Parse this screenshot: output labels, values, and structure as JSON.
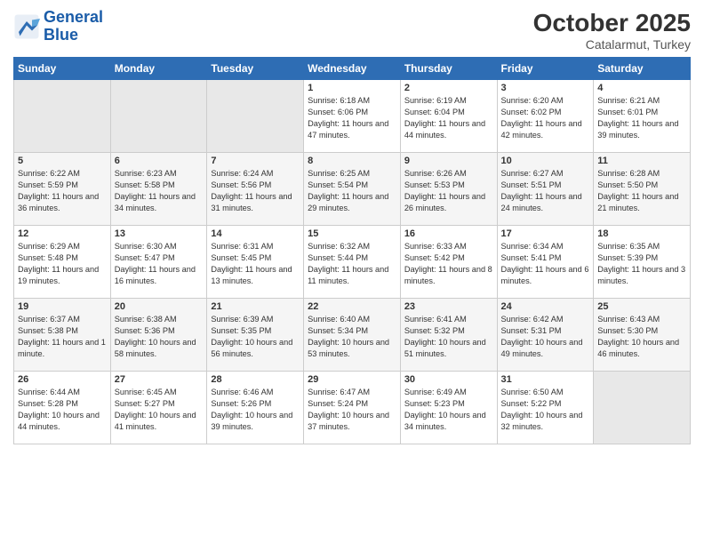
{
  "header": {
    "logo_line1": "General",
    "logo_line2": "Blue",
    "month_title": "October 2025",
    "location": "Catalarmut, Turkey"
  },
  "weekdays": [
    "Sunday",
    "Monday",
    "Tuesday",
    "Wednesday",
    "Thursday",
    "Friday",
    "Saturday"
  ],
  "weeks": [
    [
      {
        "day": "",
        "info": ""
      },
      {
        "day": "",
        "info": ""
      },
      {
        "day": "",
        "info": ""
      },
      {
        "day": "1",
        "info": "Sunrise: 6:18 AM\nSunset: 6:06 PM\nDaylight: 11 hours\nand 47 minutes."
      },
      {
        "day": "2",
        "info": "Sunrise: 6:19 AM\nSunset: 6:04 PM\nDaylight: 11 hours\nand 44 minutes."
      },
      {
        "day": "3",
        "info": "Sunrise: 6:20 AM\nSunset: 6:02 PM\nDaylight: 11 hours\nand 42 minutes."
      },
      {
        "day": "4",
        "info": "Sunrise: 6:21 AM\nSunset: 6:01 PM\nDaylight: 11 hours\nand 39 minutes."
      }
    ],
    [
      {
        "day": "5",
        "info": "Sunrise: 6:22 AM\nSunset: 5:59 PM\nDaylight: 11 hours\nand 36 minutes."
      },
      {
        "day": "6",
        "info": "Sunrise: 6:23 AM\nSunset: 5:58 PM\nDaylight: 11 hours\nand 34 minutes."
      },
      {
        "day": "7",
        "info": "Sunrise: 6:24 AM\nSunset: 5:56 PM\nDaylight: 11 hours\nand 31 minutes."
      },
      {
        "day": "8",
        "info": "Sunrise: 6:25 AM\nSunset: 5:54 PM\nDaylight: 11 hours\nand 29 minutes."
      },
      {
        "day": "9",
        "info": "Sunrise: 6:26 AM\nSunset: 5:53 PM\nDaylight: 11 hours\nand 26 minutes."
      },
      {
        "day": "10",
        "info": "Sunrise: 6:27 AM\nSunset: 5:51 PM\nDaylight: 11 hours\nand 24 minutes."
      },
      {
        "day": "11",
        "info": "Sunrise: 6:28 AM\nSunset: 5:50 PM\nDaylight: 11 hours\nand 21 minutes."
      }
    ],
    [
      {
        "day": "12",
        "info": "Sunrise: 6:29 AM\nSunset: 5:48 PM\nDaylight: 11 hours\nand 19 minutes."
      },
      {
        "day": "13",
        "info": "Sunrise: 6:30 AM\nSunset: 5:47 PM\nDaylight: 11 hours\nand 16 minutes."
      },
      {
        "day": "14",
        "info": "Sunrise: 6:31 AM\nSunset: 5:45 PM\nDaylight: 11 hours\nand 13 minutes."
      },
      {
        "day": "15",
        "info": "Sunrise: 6:32 AM\nSunset: 5:44 PM\nDaylight: 11 hours\nand 11 minutes."
      },
      {
        "day": "16",
        "info": "Sunrise: 6:33 AM\nSunset: 5:42 PM\nDaylight: 11 hours\nand 8 minutes."
      },
      {
        "day": "17",
        "info": "Sunrise: 6:34 AM\nSunset: 5:41 PM\nDaylight: 11 hours\nand 6 minutes."
      },
      {
        "day": "18",
        "info": "Sunrise: 6:35 AM\nSunset: 5:39 PM\nDaylight: 11 hours\nand 3 minutes."
      }
    ],
    [
      {
        "day": "19",
        "info": "Sunrise: 6:37 AM\nSunset: 5:38 PM\nDaylight: 11 hours\nand 1 minute."
      },
      {
        "day": "20",
        "info": "Sunrise: 6:38 AM\nSunset: 5:36 PM\nDaylight: 10 hours\nand 58 minutes."
      },
      {
        "day": "21",
        "info": "Sunrise: 6:39 AM\nSunset: 5:35 PM\nDaylight: 10 hours\nand 56 minutes."
      },
      {
        "day": "22",
        "info": "Sunrise: 6:40 AM\nSunset: 5:34 PM\nDaylight: 10 hours\nand 53 minutes."
      },
      {
        "day": "23",
        "info": "Sunrise: 6:41 AM\nSunset: 5:32 PM\nDaylight: 10 hours\nand 51 minutes."
      },
      {
        "day": "24",
        "info": "Sunrise: 6:42 AM\nSunset: 5:31 PM\nDaylight: 10 hours\nand 49 minutes."
      },
      {
        "day": "25",
        "info": "Sunrise: 6:43 AM\nSunset: 5:30 PM\nDaylight: 10 hours\nand 46 minutes."
      }
    ],
    [
      {
        "day": "26",
        "info": "Sunrise: 6:44 AM\nSunset: 5:28 PM\nDaylight: 10 hours\nand 44 minutes."
      },
      {
        "day": "27",
        "info": "Sunrise: 6:45 AM\nSunset: 5:27 PM\nDaylight: 10 hours\nand 41 minutes."
      },
      {
        "day": "28",
        "info": "Sunrise: 6:46 AM\nSunset: 5:26 PM\nDaylight: 10 hours\nand 39 minutes."
      },
      {
        "day": "29",
        "info": "Sunrise: 6:47 AM\nSunset: 5:24 PM\nDaylight: 10 hours\nand 37 minutes."
      },
      {
        "day": "30",
        "info": "Sunrise: 6:49 AM\nSunset: 5:23 PM\nDaylight: 10 hours\nand 34 minutes."
      },
      {
        "day": "31",
        "info": "Sunrise: 6:50 AM\nSunset: 5:22 PM\nDaylight: 10 hours\nand 32 minutes."
      },
      {
        "day": "",
        "info": ""
      }
    ]
  ]
}
